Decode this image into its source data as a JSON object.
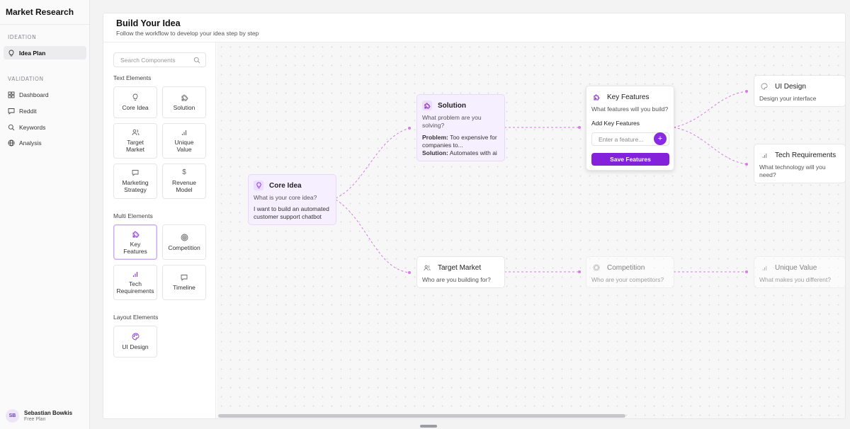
{
  "sidebar": {
    "brand": "Market Research",
    "sections": [
      {
        "label": "IDEATION",
        "items": [
          {
            "label": "Idea Plan",
            "icon": "lightbulb-icon",
            "active": true
          }
        ]
      },
      {
        "label": "VALIDATION",
        "items": [
          {
            "label": "Dashboard",
            "icon": "grid-icon"
          },
          {
            "label": "Reddit",
            "icon": "chat-icon"
          },
          {
            "label": "Keywords",
            "icon": "search-icon"
          },
          {
            "label": "Analysis",
            "icon": "globe-icon"
          }
        ]
      }
    ],
    "user": {
      "initials": "SB",
      "name": "Sebastian Bowkis",
      "plan": "Free Plan"
    }
  },
  "header": {
    "title": "Build Your Idea",
    "subtitle": "Follow the workflow to develop your idea step by step"
  },
  "palette": {
    "search_placeholder": "Search Components",
    "sections": [
      {
        "label": "Text Elements",
        "tiles": [
          "Core Idea",
          "Solution",
          "Target Market",
          "Unique Value",
          "Marketing Strategy",
          "Revenue Model"
        ]
      },
      {
        "label": "Multi Elements",
        "tiles": [
          "Key Features",
          "Competition",
          "Tech Requirements",
          "Timeline"
        ]
      },
      {
        "label": "Layout Elements",
        "tiles": [
          "UI Design"
        ]
      }
    ]
  },
  "canvas": {
    "core_idea": {
      "title": "Core Idea",
      "question": "What is your core idea?",
      "answer": "I want to build an automated customer support chatbot"
    },
    "solution": {
      "title": "Solution",
      "question": "What problem are you solving?",
      "problem_label": "Problem:",
      "problem_text": "Too expensive for companies to...",
      "solution_label": "Solution:",
      "solution_text": "Automates with ai"
    },
    "key_features": {
      "title": "Key Features",
      "question": "What features will you build?",
      "add_label": "Add Key Features",
      "input_placeholder": "Enter a feature...",
      "add_button": "+",
      "save_button": "Save Features"
    },
    "ui_design": {
      "title": "UI Design",
      "question": "Design your interface"
    },
    "tech_requirements": {
      "title": "Tech Requirements",
      "question": "What technology will you need?"
    },
    "target_market": {
      "title": "Target Market",
      "question": "Who are you building for?"
    },
    "competition": {
      "title": "Competition",
      "question": "Who are your competitors?"
    },
    "unique_value": {
      "title": "Unique Value",
      "question": "What makes you different?"
    }
  },
  "colors": {
    "accent": "#8321db",
    "accent_light": "#f6efff",
    "edge": "#d77be6"
  }
}
